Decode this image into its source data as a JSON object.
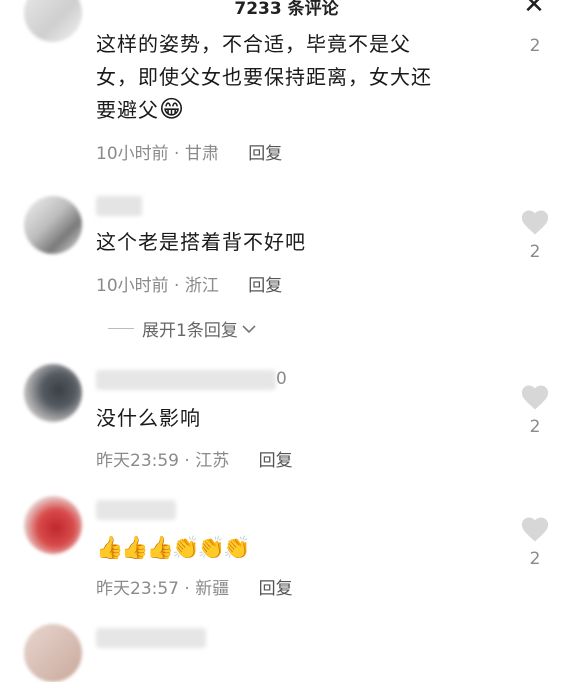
{
  "header": {
    "title": "7233 条评论",
    "close_icon": "close-icon"
  },
  "comments": [
    {
      "text_line1": "这样的姿势，不合适，毕竟不是父",
      "text_line2": "女，即使父女也要保持距离，女大还",
      "text_line3": "要避父",
      "emoji": "😁",
      "time": "10小时前 · 甘肃",
      "reply": "回复",
      "likes": "2"
    },
    {
      "text_line1": "这个老是搭着背不好吧",
      "time": "10小时前 · 浙江",
      "reply": "回复",
      "likes": "2",
      "expand": "展开1条回复"
    },
    {
      "username_suffix": "0",
      "text_line1": "没什么影响",
      "time": "昨天23:59 · 江苏",
      "reply": "回复",
      "likes": "2"
    },
    {
      "emojis": "👍👍👍👏👏👏",
      "time": "昨天23:57 · 新疆",
      "reply": "回复",
      "likes": "2"
    }
  ],
  "colors": {
    "heart": "#d7d7d7",
    "meta": "#8a8a8a",
    "text": "#1a1a1a"
  }
}
